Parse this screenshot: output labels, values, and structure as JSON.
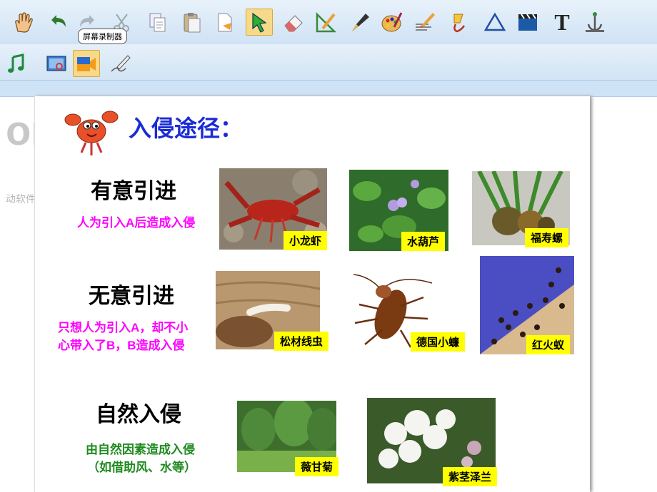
{
  "toolbar": {
    "tooltip": "屏幕录制器",
    "text_tool_label": "T",
    "row1": [
      "hand-icon",
      "undo-icon",
      "redo-icon",
      "cut-icon",
      "copy-icon",
      "paste-icon",
      "paste-special-icon",
      "select-arrow-icon",
      "eraser-icon",
      "ruler-pen-icon",
      "fountain-pen-icon",
      "palette-icon",
      "brush-icon",
      "pour-icon",
      "triangle-icon",
      "clapper-icon",
      "text-icon",
      "anchor-icon"
    ],
    "row2": [
      "music-icon",
      "screenshot-icon",
      "screen-recorder-icon",
      "signature-pen-icon"
    ]
  },
  "background": {
    "big_text": "on",
    "small_text": "动软件后消失。"
  },
  "slide": {
    "title": "入侵途径：",
    "sections": [
      {
        "heading": "有意引进",
        "desc": "人为引入A后造成入侵",
        "color": "#ff00ff"
      },
      {
        "heading": "无意引进",
        "desc_line1": "只想人为引入A，却不小",
        "desc_line2": "心带入了B，B造成入侵",
        "color": "#ff00ff"
      },
      {
        "heading": "自然入侵",
        "desc_line1": "由自然因素造成入侵",
        "desc_line2": "（如借助风、水等）",
        "color": "#1e8a1e"
      }
    ],
    "images": [
      {
        "label": "小龙虾"
      },
      {
        "label": "水葫芦"
      },
      {
        "label": "福寿螺"
      },
      {
        "label": "松材线虫"
      },
      {
        "label": "德国小蠊"
      },
      {
        "label": "红火蚁"
      },
      {
        "label": "薇甘菊"
      },
      {
        "label": "紫茎泽兰"
      }
    ]
  }
}
